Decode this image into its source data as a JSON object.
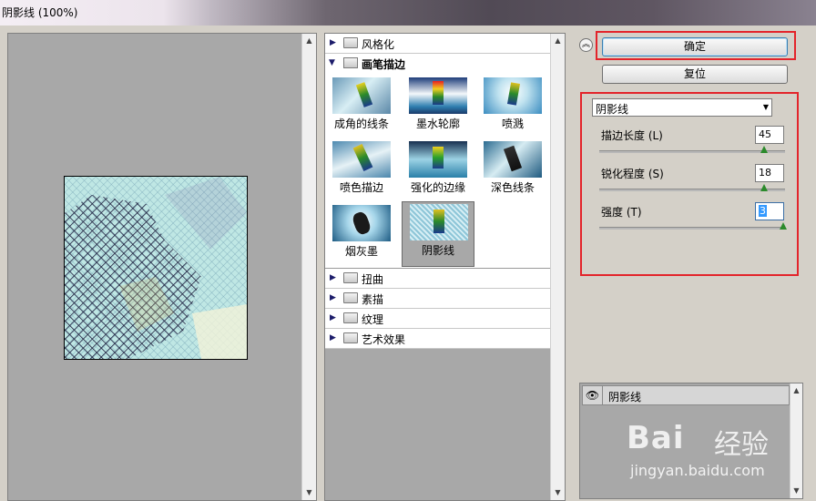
{
  "window": {
    "title": "阴影线 (100%)"
  },
  "gallery": {
    "categories_top": [
      {
        "label": "风格化"
      }
    ],
    "open_category": {
      "label": "画笔描边",
      "thumbs": [
        {
          "label": "成角的线条",
          "selected": false
        },
        {
          "label": "墨水轮廓",
          "selected": false
        },
        {
          "label": "喷溅",
          "selected": false
        },
        {
          "label": "喷色描边",
          "selected": false
        },
        {
          "label": "强化的边缘",
          "selected": false
        },
        {
          "label": "深色线条",
          "selected": false
        },
        {
          "label": "烟灰墨",
          "selected": false
        },
        {
          "label": "阴影线",
          "selected": true
        }
      ]
    },
    "categories_bottom": [
      {
        "label": "扭曲"
      },
      {
        "label": "素描"
      },
      {
        "label": "纹理"
      },
      {
        "label": "艺术效果"
      }
    ]
  },
  "buttons": {
    "ok_label": "确定",
    "reset_label": "复位",
    "collapse_icon": "double-chevron-up-icon"
  },
  "filter_select": {
    "value": "阴影线"
  },
  "params": [
    {
      "label": "描边长度 (L)",
      "value": "45",
      "slider_fraction": 0.89
    },
    {
      "label": "锐化程度 (S)",
      "value": "18",
      "slider_fraction": 0.89
    },
    {
      "label": "强度 (T)",
      "value": "3",
      "slider_fraction": 1.0
    }
  ],
  "layers": [
    {
      "name": "阴影线",
      "visible_icon": "eye-icon"
    }
  ],
  "watermark": {
    "brand": "Bai",
    "brand_cn": "经验",
    "url": "jingyan.baidu.com"
  },
  "colors": {
    "highlight_red": "#e3242b",
    "canvas_gray": "#a8a8a8",
    "slider_green": "#2b8a2b"
  }
}
